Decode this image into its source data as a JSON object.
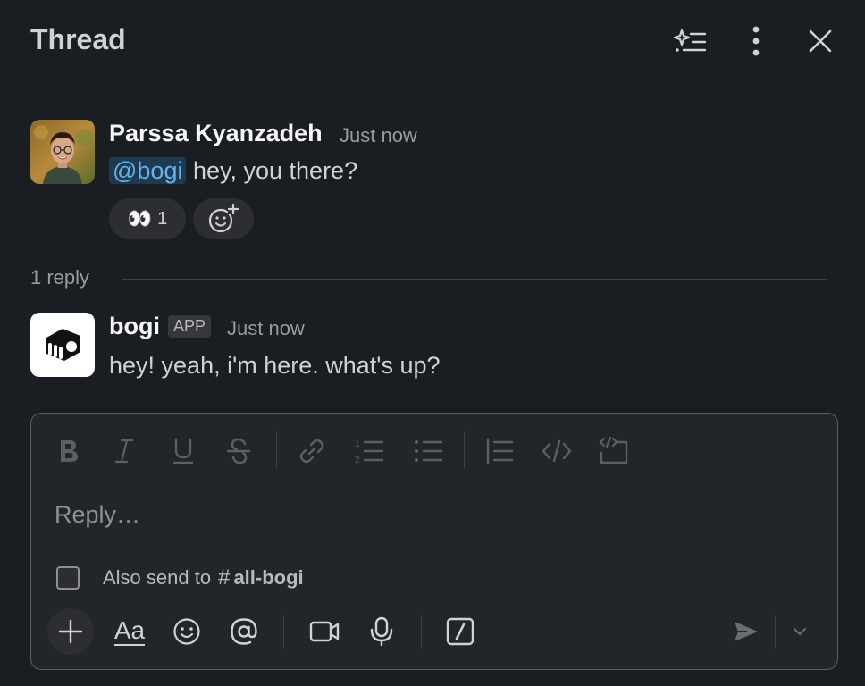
{
  "header": {
    "title": "Thread",
    "icons": [
      "ai-summary-icon",
      "more-vertical-icon",
      "close-icon"
    ]
  },
  "parent_message": {
    "author": "Parssa Kyanzadeh",
    "time": "Just now",
    "mention": "@bogi",
    "text": " hey, you there?",
    "reactions": [
      {
        "emoji": "👀",
        "count": "1"
      }
    ],
    "add_reaction_icon": "add-reaction-icon"
  },
  "replies": {
    "label": "1 reply"
  },
  "reply_message": {
    "author": "bogi",
    "badge": "APP",
    "time": "Just now",
    "text": "hey! yeah, i'm here. what's up?"
  },
  "composer": {
    "formatting": [
      "bold-icon",
      "italic-icon",
      "underline-icon",
      "strikethrough-icon",
      "link-icon",
      "ordered-list-icon",
      "bulleted-list-icon",
      "blockquote-icon",
      "code-icon",
      "code-block-icon"
    ],
    "placeholder": "Reply…",
    "also_send_label": "Also send to",
    "channel_hash": "#",
    "channel_name": "all-bogi",
    "actions": [
      "plus-icon",
      "text-format-icon",
      "emoji-icon",
      "mention-icon",
      "video-icon",
      "microphone-icon",
      "slash-command-icon",
      "send-icon",
      "chevron-down-icon"
    ],
    "text_format_label": "Aa"
  },
  "colors": {
    "background": "#1a1d21",
    "mention_bg": "#1d3a52",
    "mention_text": "#66b3e6"
  }
}
